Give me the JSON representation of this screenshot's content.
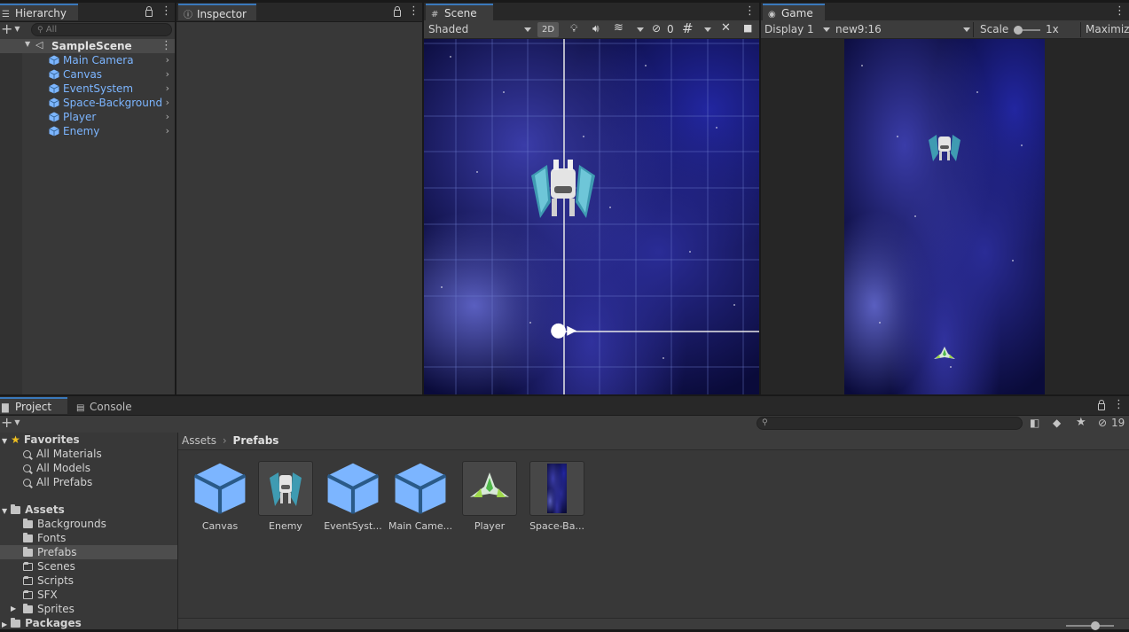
{
  "hierarchy": {
    "tab_label": "Hierarchy",
    "search_placeholder": "All",
    "scene_name": "SampleScene",
    "items": [
      {
        "label": "Main Camera"
      },
      {
        "label": "Canvas"
      },
      {
        "label": "EventSystem"
      },
      {
        "label": "Space-Background"
      },
      {
        "label": "Player"
      },
      {
        "label": "Enemy"
      }
    ]
  },
  "inspector": {
    "tab_label": "Inspector"
  },
  "scene": {
    "tab_label": "Scene",
    "shading": "Shaded",
    "mode_2d": "2D",
    "hidden_count": "0"
  },
  "game": {
    "tab_label": "Game",
    "display": "Display 1",
    "aspect": "new9:16",
    "scale_label": "Scale",
    "scale_value": "1x",
    "maximize": "Maximize"
  },
  "project": {
    "tab_label": "Project",
    "console_label": "Console",
    "hidden_count": "19",
    "breadcrumb_root": "Assets",
    "breadcrumb_current": "Prefabs",
    "favorites_label": "Favorites",
    "favorites": [
      "All Materials",
      "All Models",
      "All Prefabs"
    ],
    "assets_label": "Assets",
    "folders": [
      "Backgrounds",
      "Fonts",
      "Prefabs",
      "Scenes",
      "Scripts",
      "SFX",
      "Sprites"
    ],
    "packages_label": "Packages",
    "assets": [
      {
        "label": "Canvas",
        "icon": "prefab-cube-icon"
      },
      {
        "label": "Enemy",
        "icon": "enemy-ship-thumbnail"
      },
      {
        "label": "EventSyst...",
        "icon": "prefab-cube-icon"
      },
      {
        "label": "Main Came...",
        "icon": "prefab-cube-icon"
      },
      {
        "label": "Player",
        "icon": "player-ship-thumbnail"
      },
      {
        "label": "Space-Ba...",
        "icon": "space-background-thumbnail"
      }
    ]
  },
  "colors": {
    "accent": "#3a79bb",
    "prefab_blue": "#7cb5ff",
    "panel": "#383838",
    "selection": "#4d4d4d"
  }
}
